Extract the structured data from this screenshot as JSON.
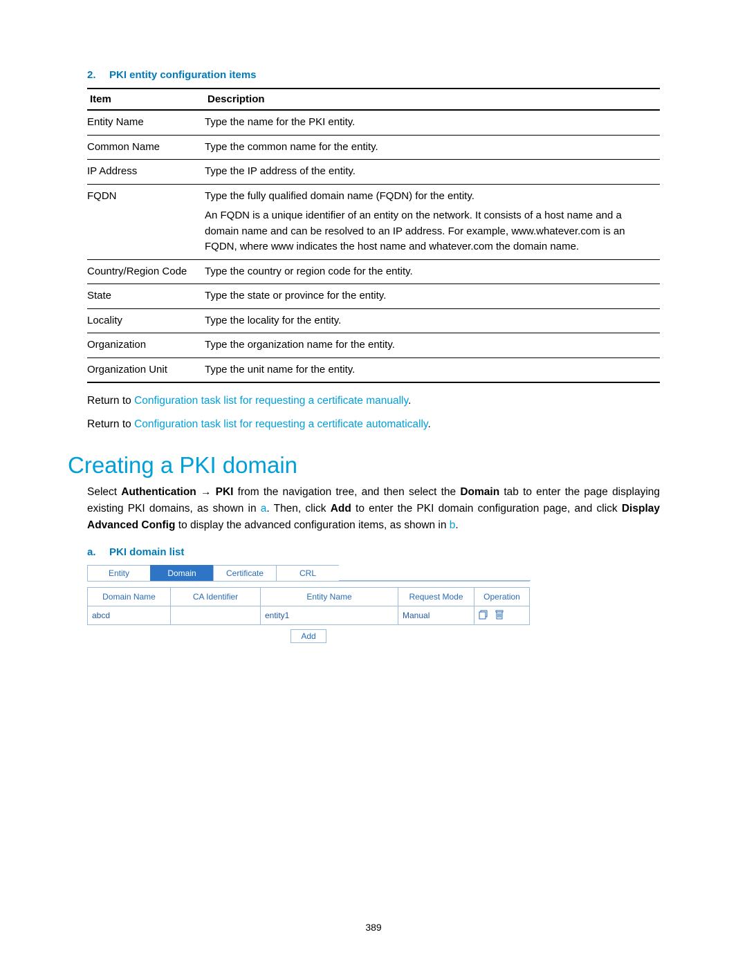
{
  "table_caption": {
    "num": "2.",
    "text": "PKI entity configuration items"
  },
  "config_table": {
    "headers": {
      "item": "Item",
      "desc": "Description"
    },
    "rows": [
      {
        "item": "Entity Name",
        "desc": "Type the name for the PKI entity."
      },
      {
        "item": "Common Name",
        "desc": "Type the common name for the entity."
      },
      {
        "item": "IP Address",
        "desc": "Type the IP address of the entity."
      },
      {
        "item": "FQDN",
        "desc_line1": "Type the fully qualified domain name (FQDN) for the entity.",
        "desc_line2": "An FQDN is a unique identifier of an entity on the network. It consists of a host name and a domain name and can be resolved to an IP address. For example, www.whatever.com is an FQDN, where www indicates the host name and whatever.com the domain name."
      },
      {
        "item": "Country/Region Code",
        "desc": "Type the country or region code for the entity."
      },
      {
        "item": "State",
        "desc": "Type the state or province for the entity."
      },
      {
        "item": "Locality",
        "desc": "Type the locality for the entity."
      },
      {
        "item": "Organization",
        "desc": "Type the organization name for the entity."
      },
      {
        "item": "Organization Unit",
        "desc": "Type the unit name for the entity."
      }
    ]
  },
  "return_lines": {
    "prefix": "Return to ",
    "link_manual": "Configuration task list for requesting a certificate manually",
    "link_auto": "Configuration task list for requesting a certificate automatically",
    "suffix": "."
  },
  "section_heading": "Creating a PKI domain",
  "section_para": {
    "t1": "Select ",
    "b1": "Authentication",
    "arrow": " → ",
    "b2": "PKI",
    "t2": " from the navigation tree, and then select the ",
    "b3": "Domain",
    "t3": " tab to enter the page displaying existing PKI domains, as shown in ",
    "link_a": "a",
    "t4": ". Then, click ",
    "b4": "Add",
    "t5": " to enter the PKI domain configuration page, and click ",
    "b5": "Display Advanced Config",
    "t6": " to display the advanced configuration items, as shown in ",
    "link_b": "b",
    "t7": "."
  },
  "figure_caption": {
    "num": "a.",
    "text": "PKI domain list"
  },
  "figure": {
    "tabs": [
      "Entity",
      "Domain",
      "Certificate",
      "CRL"
    ],
    "active_tab_index": 1,
    "grid_headers": [
      "Domain Name",
      "CA Identifier",
      "Entity Name",
      "Request Mode",
      "Operation"
    ],
    "grid_row": {
      "domain_name": "abcd",
      "ca_identifier": "",
      "entity_name": "entity1",
      "request_mode": "Manual"
    },
    "add_button": "Add"
  },
  "page_number": "389"
}
